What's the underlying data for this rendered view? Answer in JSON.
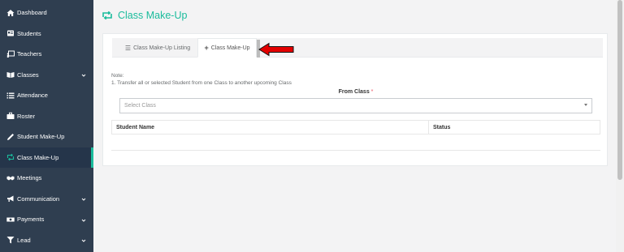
{
  "sidebar": {
    "items": [
      {
        "label": "Dashboard",
        "icon": "home-icon",
        "has_chevron": false
      },
      {
        "label": "Students",
        "icon": "id-card-icon",
        "has_chevron": false
      },
      {
        "label": "Teachers",
        "icon": "presentation-icon",
        "has_chevron": false
      },
      {
        "label": "Classes",
        "icon": "book-icon",
        "has_chevron": true
      },
      {
        "label": "Attendance",
        "icon": "list-icon",
        "has_chevron": false
      },
      {
        "label": "Roster",
        "icon": "briefcase-icon",
        "has_chevron": false
      },
      {
        "label": "Student Make-Up",
        "icon": "pencil-icon",
        "has_chevron": false
      },
      {
        "label": "Class Make-Up",
        "icon": "retweet-icon",
        "has_chevron": false,
        "active": true
      },
      {
        "label": "Meetings",
        "icon": "handshake-icon",
        "has_chevron": false
      },
      {
        "label": "Communication",
        "icon": "bullhorn-icon",
        "has_chevron": true
      },
      {
        "label": "Payments",
        "icon": "money-icon",
        "has_chevron": true
      },
      {
        "label": "Lead",
        "icon": "filter-icon",
        "has_chevron": true
      }
    ]
  },
  "page": {
    "title": "Class Make-Up",
    "title_icon": "retweet-icon"
  },
  "tabs": {
    "listing_label": "Class Make-Up Listing",
    "listing_icon": "list-icon",
    "makeup_label": "Class Make-Up",
    "makeup_icon": "plus-icon"
  },
  "note": {
    "heading": "Note:",
    "line1": "1. Transfer all or selected Student from one Class to another upcoming Class"
  },
  "form": {
    "from_class_label": "From Class",
    "required_mark": "*",
    "select_placeholder": "Select Class"
  },
  "table": {
    "headers": [
      "Student Name",
      "Status"
    ]
  },
  "colors": {
    "accent": "#1abc9c",
    "sidebar": "#2f3e50",
    "arrow": "#e30000"
  }
}
